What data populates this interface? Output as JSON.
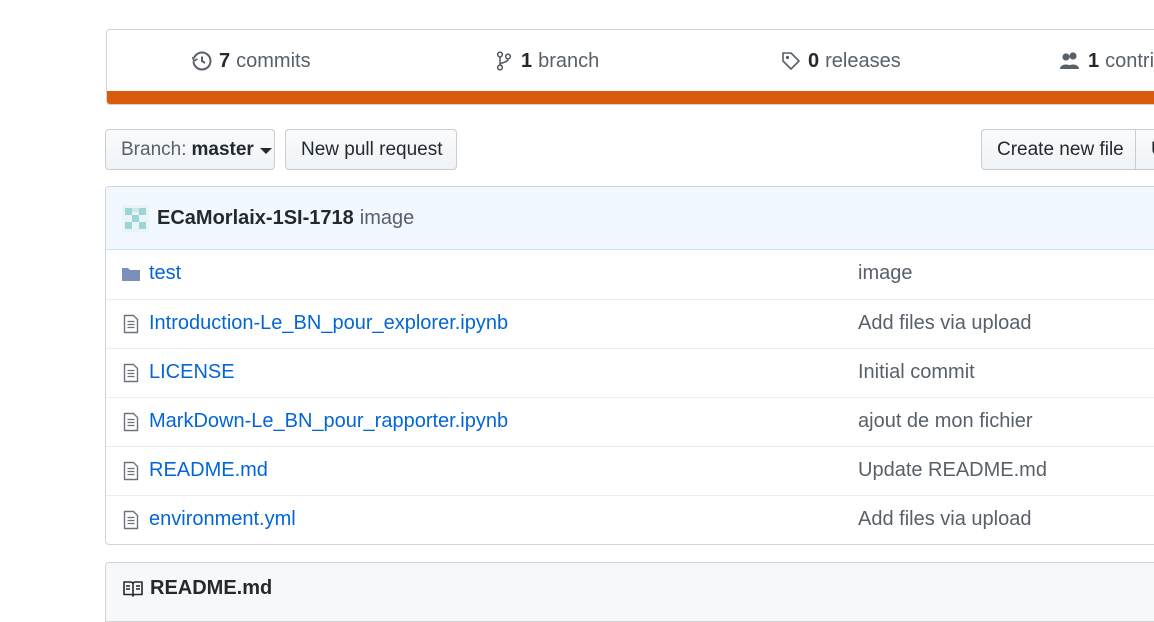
{
  "summary": {
    "commits": {
      "count": "7",
      "label": "commits",
      "icon": "history-icon"
    },
    "branches": {
      "count": "1",
      "label": "branch",
      "icon": "git-branch-icon"
    },
    "releases": {
      "count": "0",
      "label": "releases",
      "icon": "tag-icon"
    },
    "contributors": {
      "count": "1",
      "label": "contri",
      "icon": "people-icon"
    },
    "language_color": "#da5b0b"
  },
  "toolbar": {
    "branch_prefix": "Branch:",
    "branch_name": "master",
    "new_pull_request": "New pull request",
    "create_new_file": "Create new file",
    "upload_partial": "U"
  },
  "latest_commit": {
    "author": "ECaMorlaix-1SI-1718",
    "message": "image"
  },
  "files": [
    {
      "type": "dir",
      "icon": "folder-icon",
      "name": "test",
      "message": "image"
    },
    {
      "type": "file",
      "icon": "file-icon",
      "name": "Introduction-Le_BN_pour_explorer.ipynb",
      "message": "Add files via upload"
    },
    {
      "type": "file",
      "icon": "file-icon",
      "name": "LICENSE",
      "message": "Initial commit"
    },
    {
      "type": "file",
      "icon": "file-icon",
      "name": "MarkDown-Le_BN_pour_rapporter.ipynb",
      "message": "ajout de mon fichier"
    },
    {
      "type": "file",
      "icon": "file-icon",
      "name": "README.md",
      "message": "Update README.md"
    },
    {
      "type": "file",
      "icon": "file-icon",
      "name": "environment.yml",
      "message": "Add files via upload"
    }
  ],
  "readme": {
    "title": "README.md",
    "icon": "book-icon"
  },
  "colors": {
    "link": "#0366d6",
    "muted": "#586069",
    "commit_bg": "#f1f8ff"
  }
}
